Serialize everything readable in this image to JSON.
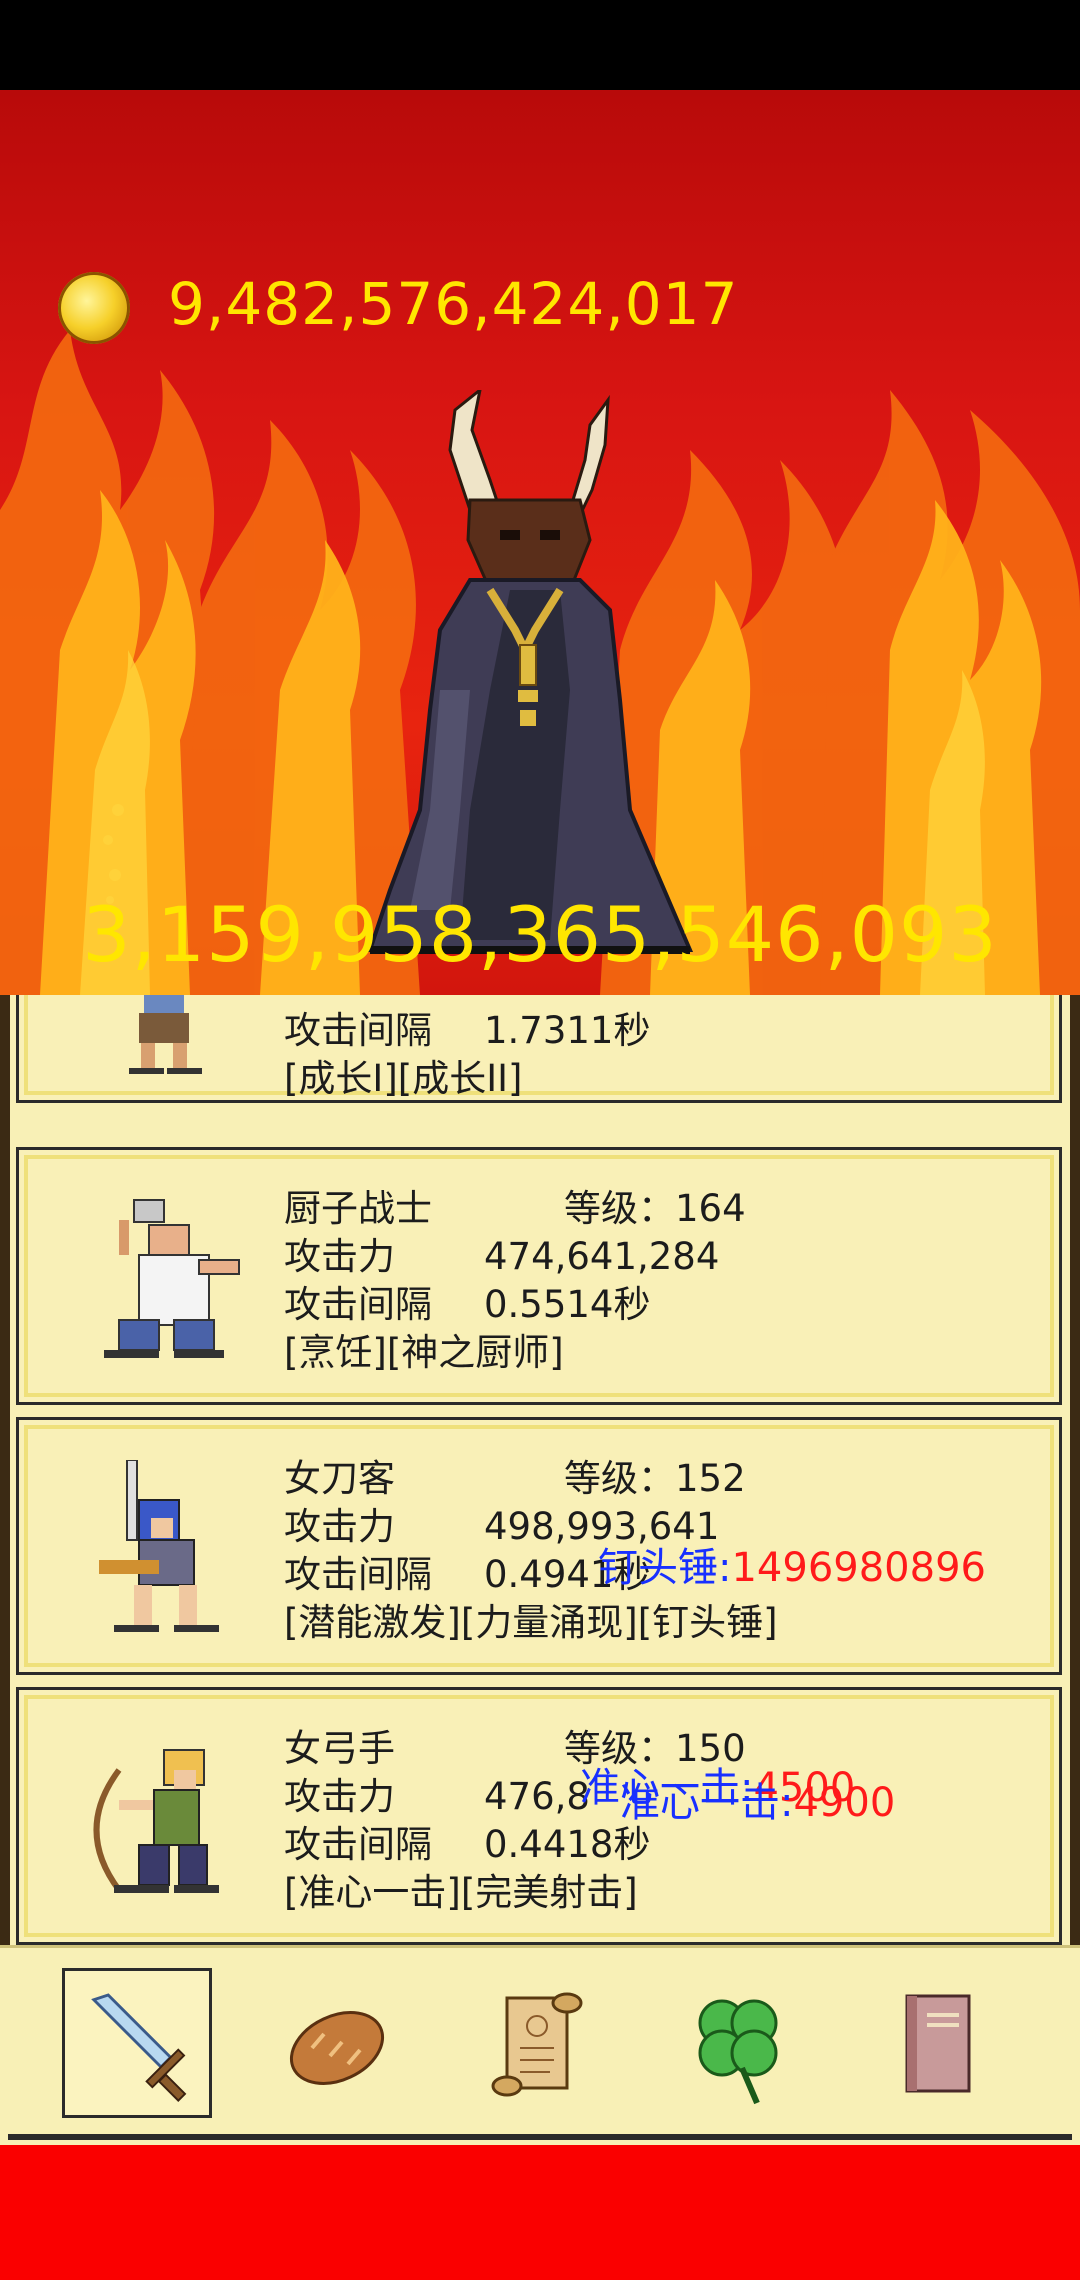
{
  "scene": {
    "gold": "9,482,576,424,017",
    "boss_hp": "3,159,958,365,546,093"
  },
  "partial_card": {
    "interval_label": "攻击间隔",
    "interval": "1.7311秒",
    "skills": "[成长I][成长II]"
  },
  "heroes": [
    {
      "name": "厨子战士",
      "level_text": "等级：164",
      "attack_label": "攻击力",
      "attack": "474,641,284",
      "interval_label": "攻击间隔",
      "interval": "0.5514秒",
      "skills": "[烹饪][神之厨师]"
    },
    {
      "name": "女刀客",
      "level_text": "等级：152",
      "attack_label": "攻击力",
      "attack": "498,993,641",
      "interval_label": "攻击间隔",
      "interval": "0.4941秒",
      "skills": "[潜能激发][力量涌现][钉头锤]"
    },
    {
      "name": "女弓手",
      "level_text": "等级：150",
      "attack_label": "攻击力",
      "attack": "476,8",
      "interval_label": "攻击间隔",
      "interval": "0.4418秒",
      "skills": "[准心一击][完美射击]"
    }
  ],
  "floating": {
    "hammer_label": "钉头锤:",
    "hammer_value": "1496980896",
    "crit1_label": "准心一击:",
    "crit1_value": "4500",
    "crit2_label": "准心一击:",
    "crit2_value": "4900"
  },
  "nav": {
    "items": [
      "sword",
      "bread",
      "scroll",
      "clover",
      "book"
    ],
    "active": "sword"
  },
  "colors": {
    "gold_text": "#ffe600",
    "card_bg": "#f9f0b7",
    "bottom_red": "#fa0000",
    "float_blue": "#1830ff",
    "float_red": "#ff1a1a"
  }
}
